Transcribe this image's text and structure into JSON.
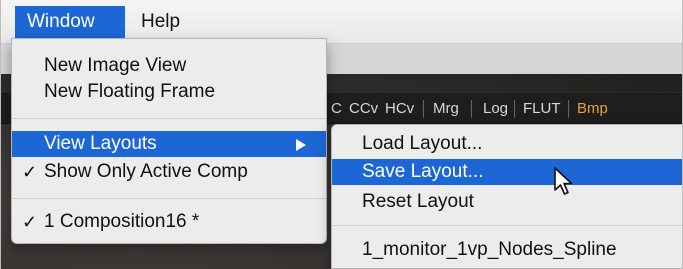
{
  "menubar": {
    "items": [
      {
        "label": "Window"
      },
      {
        "label": "Help"
      }
    ]
  },
  "toolbar": {
    "items": [
      "C",
      "CCv",
      "HCv",
      "Mrg",
      "Log",
      "FLUT",
      "Bmp"
    ]
  },
  "window_menu": {
    "items": [
      {
        "label": "New Image View",
        "checked": false
      },
      {
        "label": "New Floating Frame",
        "checked": false
      },
      {
        "label": "View Layouts",
        "checked": false,
        "submenu": true,
        "highlighted": true
      },
      {
        "label": "Show Only Active Comp",
        "checked": true
      },
      {
        "label": "1 Composition16 *",
        "checked": true
      }
    ],
    "check_symbol": "✓"
  },
  "layouts_submenu": {
    "items": [
      {
        "label": "Load Layout..."
      },
      {
        "label": "Save Layout...",
        "highlighted": true
      },
      {
        "label": "Reset Layout"
      },
      {
        "label": "1_monitor_1vp_Nodes_Spline"
      }
    ]
  },
  "colors": {
    "highlight": "#1d66d6",
    "menu_bg": "#ececec",
    "toolbar_accent": "#e6a22e"
  },
  "icons": {
    "submenu_arrow": "chevron-right-icon",
    "pointer": "mouse-pointer-icon"
  }
}
